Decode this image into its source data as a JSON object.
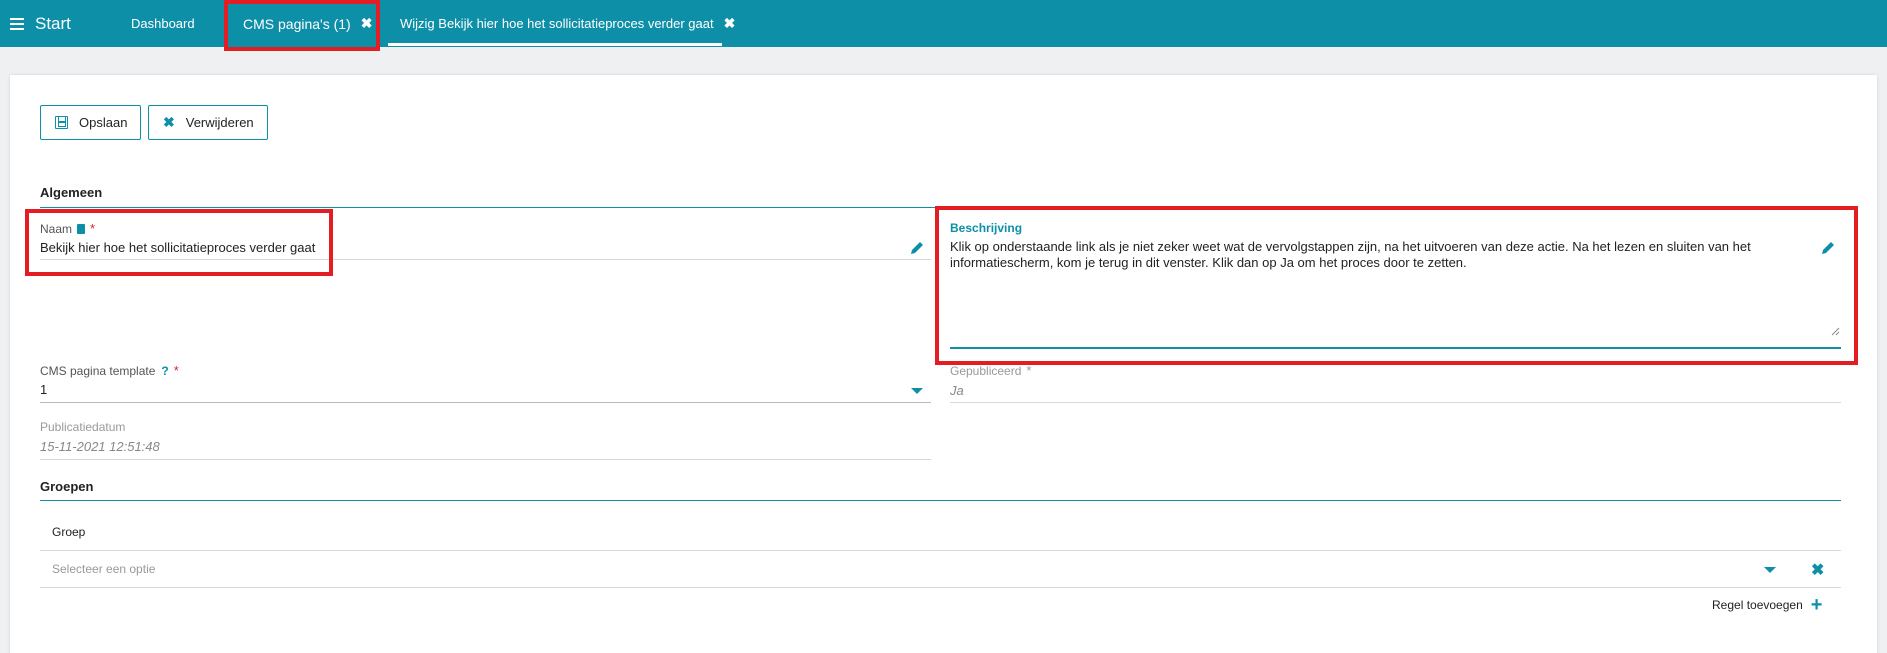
{
  "topbar": {
    "start_label": "Start",
    "tabs": [
      {
        "label": "Dashboard"
      },
      {
        "label": "CMS pagina's (1)",
        "close": "✖"
      },
      {
        "label": "Wijzig Bekijk hier hoe het sollicitatieproces verder gaat",
        "close": "✖"
      }
    ]
  },
  "toolbar": {
    "save_label": "Opslaan",
    "delete_label": "Verwijderen"
  },
  "algemeen": {
    "title": "Algemeen",
    "naam": {
      "label": "Naam",
      "required": "*",
      "value": "Bekijk hier hoe het sollicitatieproces verder gaat"
    },
    "beschrijving": {
      "label": "Beschrijving",
      "value": "Klik op onderstaande link als je niet zeker weet wat de vervolgstappen zijn, na het uitvoeren van deze actie. Na het lezen en sluiten van het informatiescherm, kom je terug in dit venster. Klik dan op Ja om het proces door te zetten."
    },
    "template": {
      "label": "CMS pagina template",
      "help": "?",
      "required": "*",
      "value": "1"
    },
    "gepubliceerd": {
      "label": "Gepubliceerd",
      "required": "*",
      "value": "Ja"
    },
    "publicatiedatum": {
      "label": "Publicatiedatum",
      "value": "15-11-2021 12:51:48"
    }
  },
  "groepen": {
    "title": "Groepen",
    "column_header": "Groep",
    "select_placeholder": "Selecteer een optie",
    "add_row_label": "Regel toevoegen"
  },
  "colors": {
    "accent": "#0e8fa8",
    "highlight": "#e21d24",
    "required": "#e21d24"
  }
}
